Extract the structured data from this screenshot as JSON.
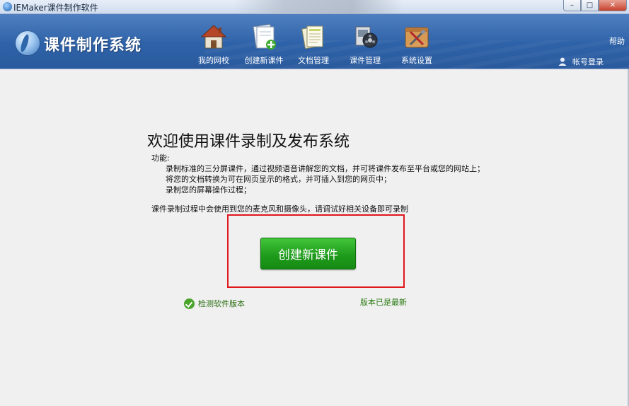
{
  "window": {
    "title": "IEMaker课件制作软件",
    "min_glyph": "–",
    "max_glyph": "□",
    "close_glyph": "✕"
  },
  "header": {
    "logo_text": "课件制作系统",
    "nav": [
      {
        "label": "我的网校",
        "icon": "house-icon"
      },
      {
        "label": "创建新课件",
        "icon": "new-document-icon"
      },
      {
        "label": "文档管理",
        "icon": "documents-icon"
      },
      {
        "label": "课件管理",
        "icon": "film-reel-icon"
      },
      {
        "label": "系统设置",
        "icon": "tools-icon"
      }
    ],
    "help_label": "帮助",
    "login_label": "帐号登录"
  },
  "main": {
    "welcome_title": "欢迎使用课件录制及发布系统",
    "features_title": "功能:",
    "features": [
      "录制标准的三分屏课件，通过视频语音讲解您的文档，并可将课件发布至平台或您的网站上；",
      "将您的文档转换为可在网页显示的格式，并可插入到您的网页中；",
      "录制您的屏幕操作过程；"
    ],
    "notice": "课件录制过程中会使用到您的麦克风和摄像头，请调试好相关设备即可录制",
    "create_button": "创建新课件",
    "check_version_link": "检测软件版本",
    "version_status": "版本已是最新"
  },
  "colors": {
    "header_blue": "#2e62a8",
    "button_green": "#1f9c1c",
    "highlight_red": "#e0171b",
    "link_green": "#2a7a12"
  }
}
